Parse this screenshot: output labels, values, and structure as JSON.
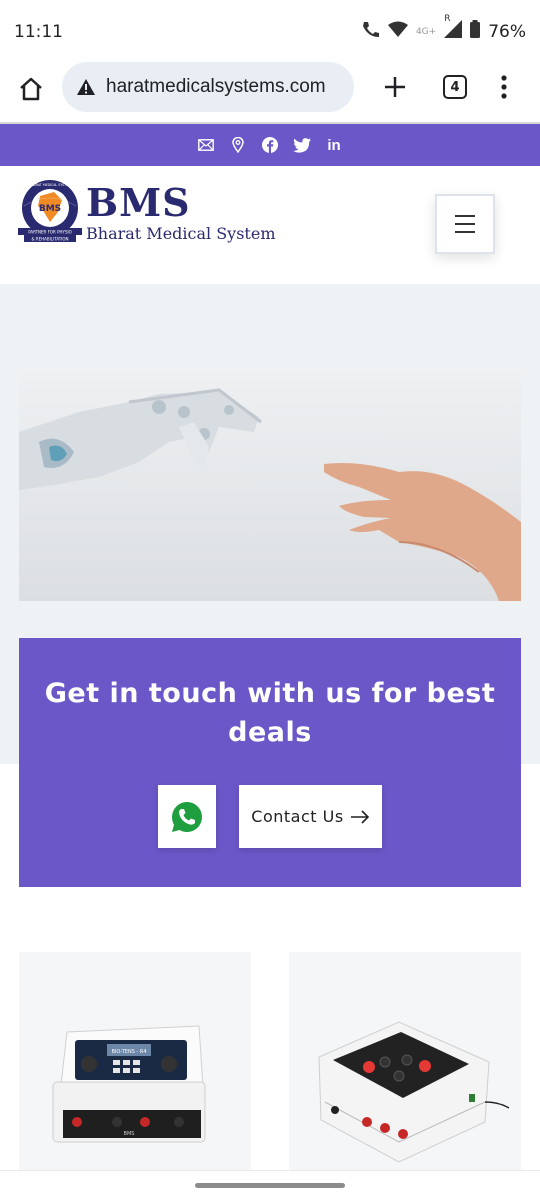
{
  "status": {
    "time": "11:11",
    "network": "4G+",
    "roaming": "R",
    "battery": "76%"
  },
  "browser": {
    "url": "haratmedicalsystems.com",
    "tab_count": "4"
  },
  "topbar": {
    "icons": [
      "mail-icon",
      "location-pin-icon",
      "facebook-icon",
      "twitter-icon",
      "linkedin-icon"
    ],
    "linkedin_text": "in",
    "color": "#6b57c8"
  },
  "header": {
    "logo_title": "BMS",
    "logo_subtitle": "Bharat Medical System",
    "emblem_ring_top": "BHARAT MEDICAL SYSTEM",
    "emblem_ring_bottom": "CHENNAI, INDIA",
    "emblem_center": "BMS",
    "emblem_ribbon_1": "PARTNER FOR PHYSIO",
    "emblem_ribbon_2": "& REHABILITATION"
  },
  "hero": {
    "image_subject": "robot-hand-and-human-hand"
  },
  "cta": {
    "title": "Get in touch with us for best deals",
    "contact_label": "Contact Us",
    "accent": "#6b57c8",
    "whatsapp_color": "#1e9e3e"
  },
  "products": [
    {
      "image_subject": "two-channel-electrotherapy-unit",
      "screen_text": "BIO-TENS - R4",
      "brand_text": "BMS"
    },
    {
      "image_subject": "dark-panel-stimulator-unit"
    }
  ]
}
